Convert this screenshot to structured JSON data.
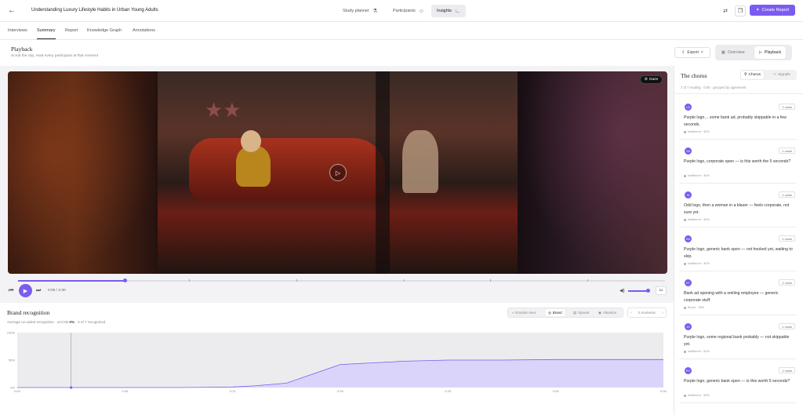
{
  "header": {
    "title": "Understanding Luxury Lifestyle Habits in Urban Young Adults",
    "nav": [
      {
        "label": "Study planner",
        "icon": "flask-icon"
      },
      {
        "label": "Participants",
        "icon": "users-icon"
      },
      {
        "label": "Insights",
        "icon": "chart-icon"
      }
    ],
    "create_report": "Create Report"
  },
  "subtabs": [
    "Interviews",
    "Summary",
    "Report",
    "Knowledge Graph",
    "Annotations"
  ],
  "playback": {
    "title": "Playback",
    "subtitle": "Scrub the clip, read every participant at that moment",
    "export": "Export",
    "view_toggle": [
      "Overview",
      "Playback"
    ],
    "gaze": "Gaze",
    "time": "0:06 / 2:30",
    "speed": "1x",
    "progress": 0.165,
    "volume": 0.85
  },
  "brand": {
    "title": "Brand recognition",
    "subtitle_pre": "Average un-aided recognition · at 0:05",
    "subtitle_bold": "0%",
    "subtitle_post": "· 0 of 7 recognized",
    "tabs": [
      "Emotion river",
      "Brand",
      "Spread",
      "Attention"
    ],
    "moments": "5 moments"
  },
  "chart_data": {
    "type": "area",
    "x": [
      0,
      5,
      10,
      15,
      20,
      22,
      25,
      30,
      35,
      36,
      40,
      45,
      50,
      55,
      60
    ],
    "y": [
      0,
      0,
      0,
      0,
      1,
      3,
      8,
      42,
      47,
      48,
      50,
      50,
      51,
      51,
      51
    ],
    "x_ticks": [
      "0:00",
      "0:05",
      "0:10",
      "0:15",
      "0:20",
      "0:25",
      "0:30"
    ],
    "y_ticks": [
      "100%",
      "50%",
      "0%"
    ],
    "ylim": [
      0,
      100
    ],
    "cursor_x": 5,
    "grid": false,
    "colors": {
      "line": "#7a5cf0",
      "fill": "#d9d2fb"
    }
  },
  "chorus": {
    "title": "The chorus",
    "toggle": [
      "Chorus",
      "Signals"
    ],
    "subtitle": "7 of 7 reading · 0:05 · grouped by agreement",
    "cards": [
      {
        "initials": "LG",
        "count": "1 voice",
        "quote": "Purple logo… some bank ad, probably skippable in a few seconds.",
        "meta": "Indifferent · 40%"
      },
      {
        "initials": "SA",
        "count": "1 voice",
        "quote": "Purple logo, corporate open — is this worth the 5 seconds?",
        "meta": "Indifferent · 40%"
      },
      {
        "initials": "M",
        "count": "1 voice",
        "quote": "Odd logo, then a woman in a blazer — feels corporate, not sure yet.",
        "meta": "Indifferent · 40%"
      },
      {
        "initials": "RA",
        "count": "1 voice",
        "quote": "Purple logo, generic bank open — not hooked yet, waiting to skip.",
        "meta": "Indifferent · 40%"
      },
      {
        "initials": "ET",
        "count": "1 voice",
        "quote": "Bank ad opening with a smiling employee — generic corporate stuff.",
        "meta": "Bored · 35%"
      },
      {
        "initials": "JO",
        "count": "1 voice",
        "quote": "Purple logo, some regional bank probably — not skippable yet.",
        "meta": "Indifferent · 50%"
      },
      {
        "initials": "PO",
        "count": "1 voice",
        "quote": "Purple logo, generic bank open — is this worth 5 seconds?",
        "meta": "Indifferent · 50%"
      }
    ]
  }
}
